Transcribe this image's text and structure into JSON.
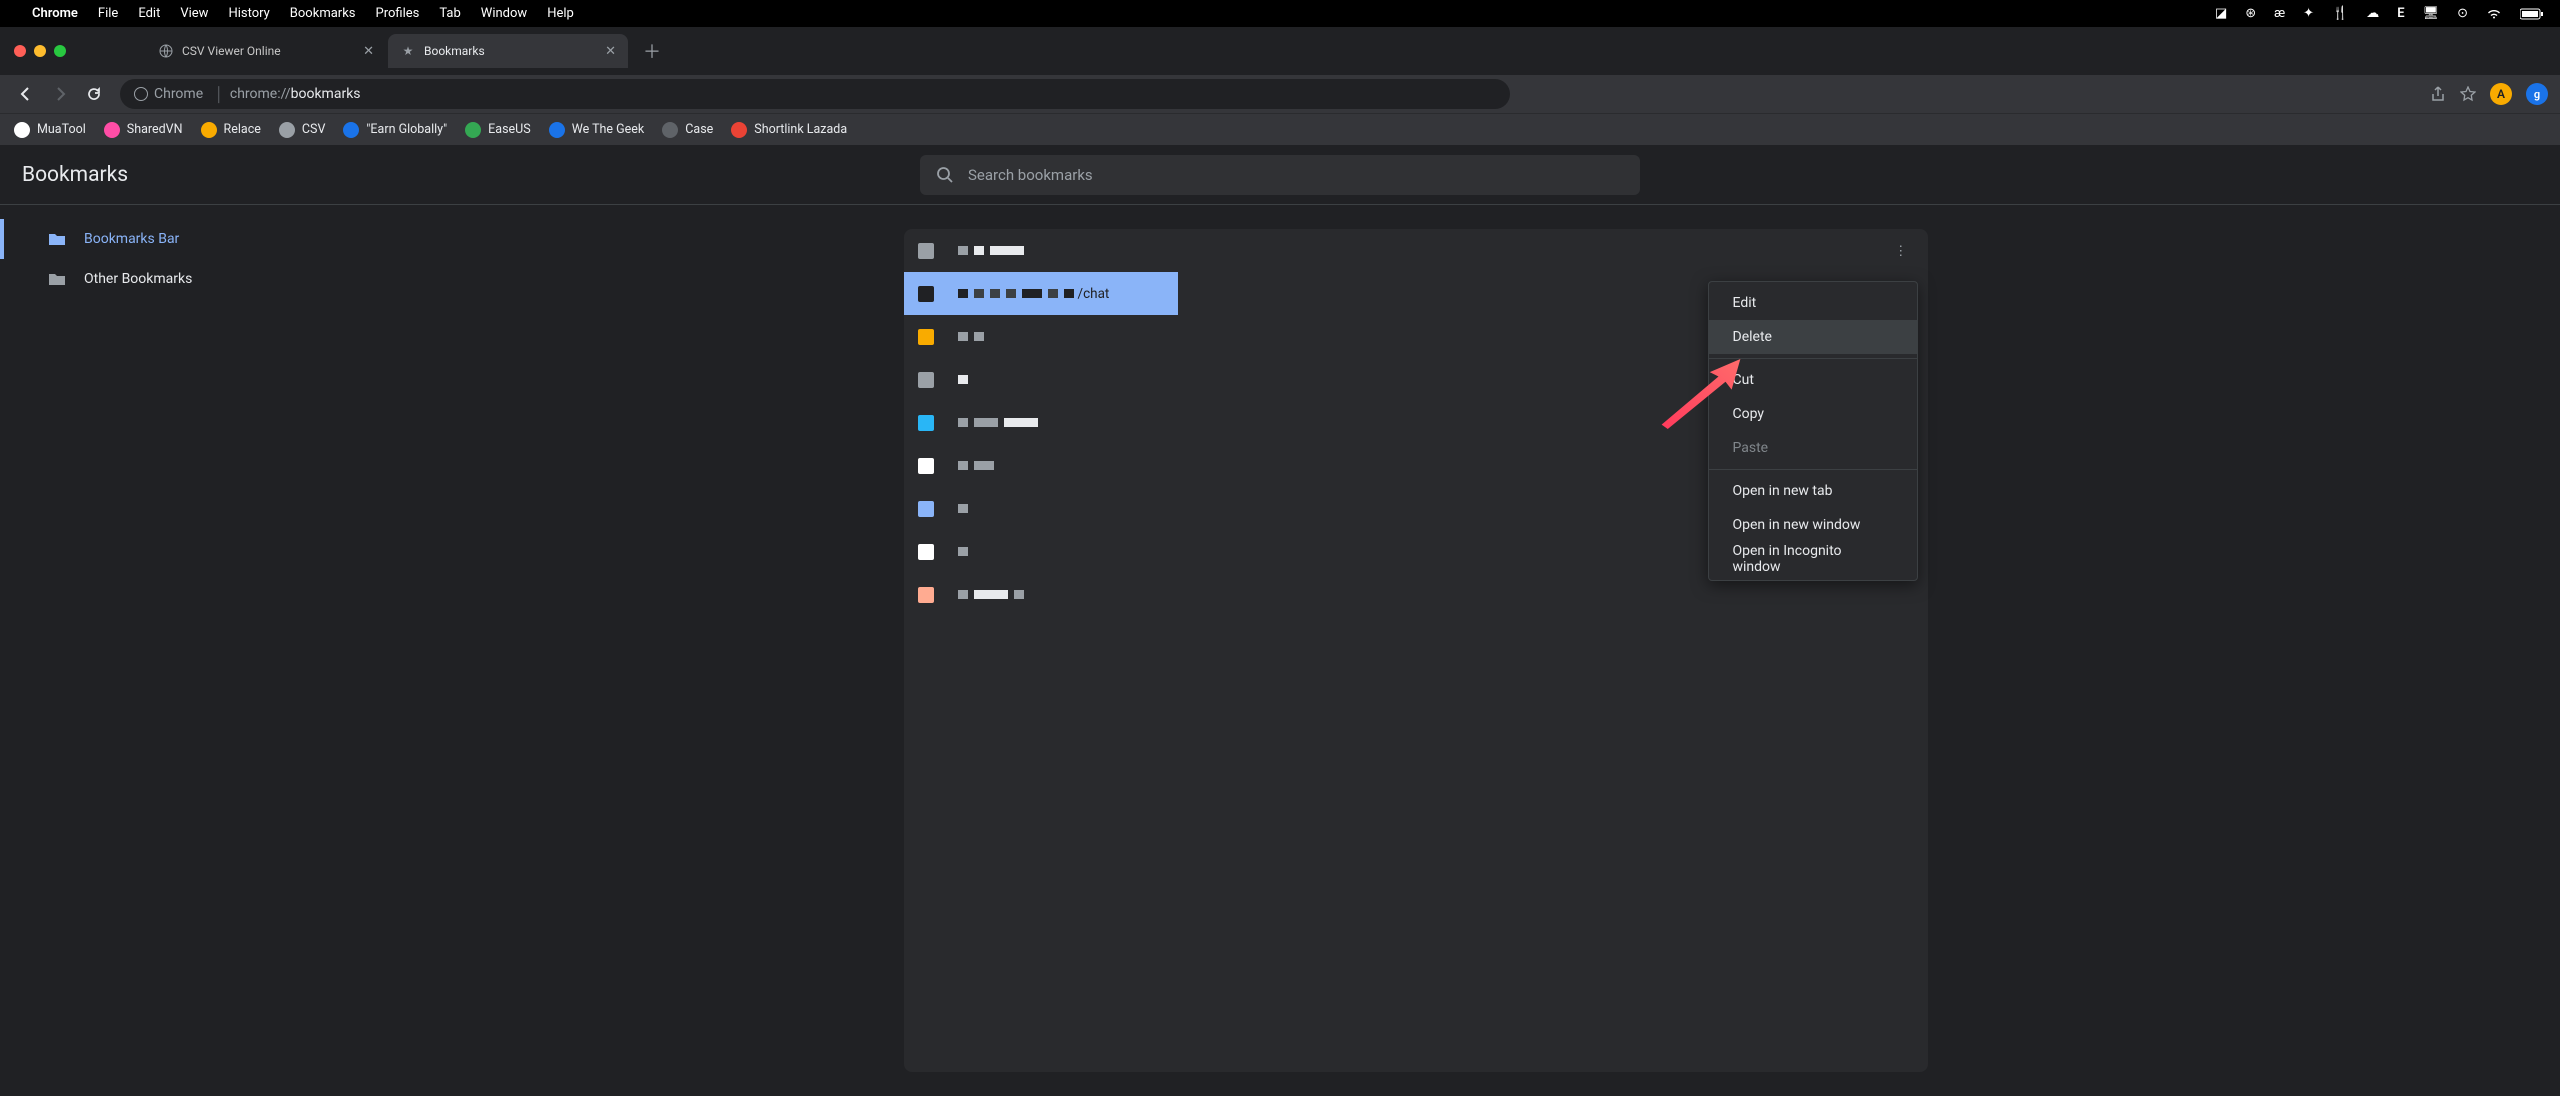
{
  "macos": {
    "app": "Chrome",
    "menus": [
      "File",
      "Edit",
      "View",
      "History",
      "Bookmarks",
      "Profiles",
      "Tab",
      "Window",
      "Help"
    ]
  },
  "tabs": {
    "items": [
      {
        "title": "CSV Viewer Online",
        "active": false
      },
      {
        "title": "Bookmarks",
        "active": true
      }
    ]
  },
  "omnibox": {
    "chip": "Chrome",
    "prefix": "chrome://",
    "path": "bookmarks"
  },
  "bookmarksbar": {
    "items": [
      {
        "label": "MuaTool",
        "favColor": "#ffffff"
      },
      {
        "label": "SharedVN",
        "favColor": "#ff4da6"
      },
      {
        "label": "Relace",
        "favColor": "#f9ab00"
      },
      {
        "label": "CSV",
        "favColor": "#9aa0a6"
      },
      {
        "label": "\"Earn Globally\"",
        "favColor": "#1a73e8"
      },
      {
        "label": "EaseUS",
        "favColor": "#34a853"
      },
      {
        "label": "We The Geek",
        "favColor": "#1a73e8"
      },
      {
        "label": "Case",
        "favColor": "#5f6368"
      },
      {
        "label": "Shortlink Lazada",
        "favColor": "#ea4335"
      }
    ]
  },
  "bm": {
    "title": "Bookmarks",
    "search_placeholder": "Search bookmarks",
    "sidebar": {
      "items": [
        {
          "label": "Bookmarks Bar",
          "active": true
        },
        {
          "label": "Other Bookmarks",
          "active": false
        }
      ]
    },
    "list": {
      "rows": [
        {
          "favColor": "#9aa0a6",
          "selected": false,
          "suffix": ""
        },
        {
          "favColor": "#202124",
          "selected": true,
          "suffix": "/chat"
        },
        {
          "favColor": "#f9ab00",
          "selected": false,
          "suffix": ""
        },
        {
          "favColor": "#9aa0a6",
          "selected": false,
          "suffix": ""
        },
        {
          "favColor": "#29b6f6",
          "selected": false,
          "suffix": ""
        },
        {
          "favColor": "#ffffff",
          "selected": false,
          "suffix": ""
        },
        {
          "favColor": "#8ab4f8",
          "selected": false,
          "suffix": ""
        },
        {
          "favColor": "#ffffff",
          "selected": false,
          "suffix": ""
        },
        {
          "favColor": "#ffab91",
          "selected": false,
          "suffix": ""
        }
      ]
    },
    "context_menu": {
      "items": [
        {
          "label": "Edit",
          "hover": false,
          "disabled": false
        },
        {
          "label": "Delete",
          "hover": true,
          "disabled": false
        },
        "sep",
        {
          "label": "Cut",
          "hover": false,
          "disabled": false
        },
        {
          "label": "Copy",
          "hover": false,
          "disabled": false
        },
        {
          "label": "Paste",
          "hover": false,
          "disabled": true
        },
        "sep",
        {
          "label": "Open in new tab",
          "hover": false,
          "disabled": false
        },
        {
          "label": "Open in new window",
          "hover": false,
          "disabled": false
        },
        {
          "label": "Open in Incognito window",
          "hover": false,
          "disabled": false
        }
      ]
    }
  },
  "avatar_initial": "A",
  "ext_initial": "g"
}
